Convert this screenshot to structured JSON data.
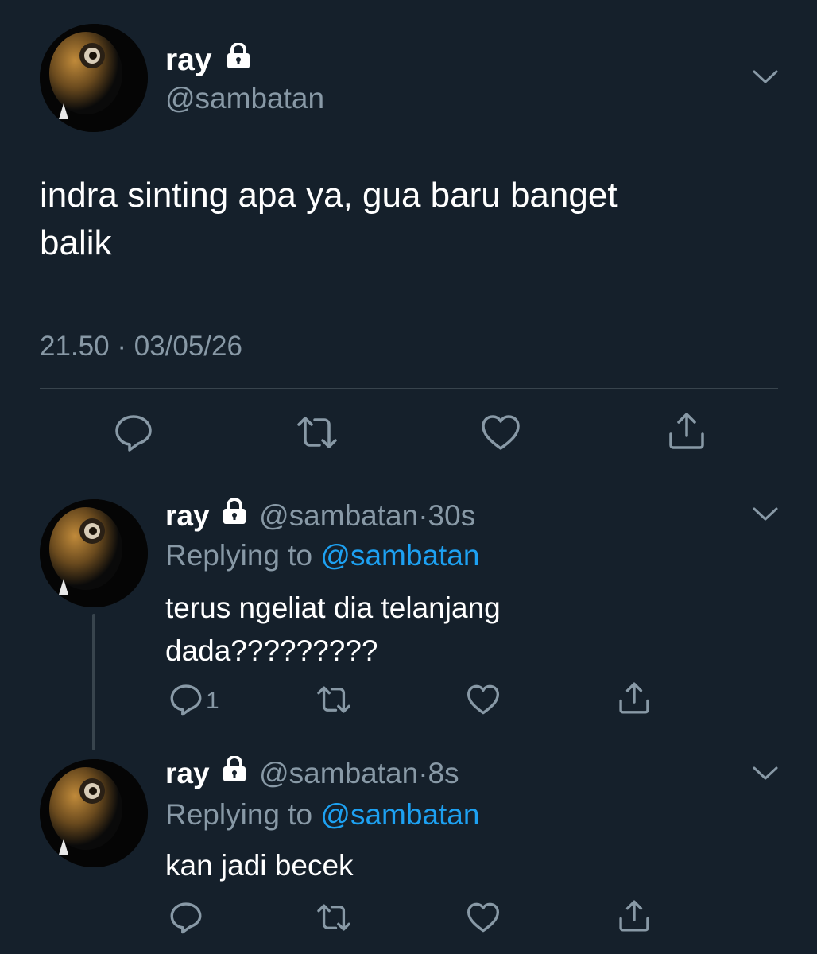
{
  "main_tweet": {
    "display_name": "ray",
    "handle": "@sambatan",
    "text_line1": "indra sinting apa ya, gua baru banget",
    "text_line2": "balik",
    "time": "21.50",
    "separator": "·",
    "date": "03/05/26"
  },
  "replies": [
    {
      "display_name": "ray",
      "handle": "@sambatan",
      "dot": "·",
      "age": "30s",
      "replying_prefix": "Replying to",
      "replying_to": "@sambatan",
      "text_line1": "terus ngeliat dia telanjang",
      "text_line2": "dada?????????",
      "reply_count": "1"
    },
    {
      "display_name": "ray",
      "handle": "@sambatan",
      "dot": "·",
      "age": "8s",
      "replying_prefix": "Replying to",
      "replying_to": "@sambatan",
      "text_line1": "kan jadi becek",
      "reply_count": ""
    }
  ],
  "colors": {
    "background": "#15202b",
    "text": "#ffffff",
    "muted": "#8899a6",
    "link": "#1da1f2",
    "divider": "#38444d"
  },
  "icons": [
    "lock-icon",
    "chevron-down-icon",
    "reply-icon",
    "retweet-icon",
    "like-icon",
    "share-icon"
  ]
}
